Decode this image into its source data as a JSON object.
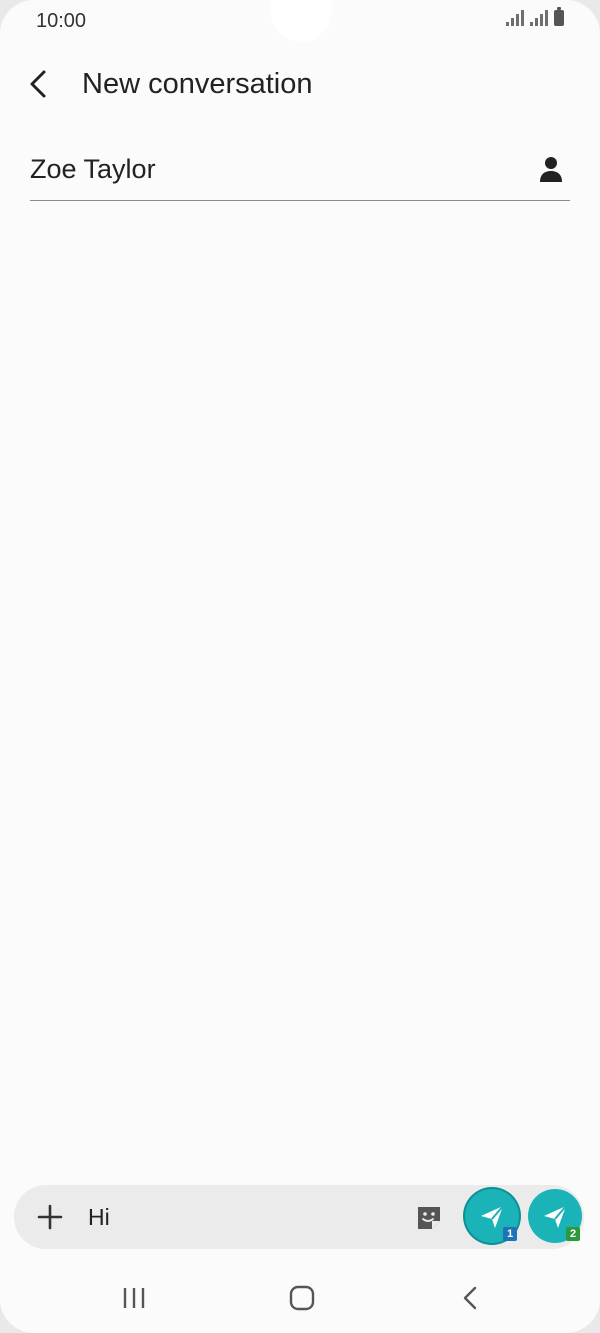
{
  "status_bar": {
    "time": "10:00"
  },
  "header": {
    "title": "New conversation",
    "back_icon": "chevron-left-icon"
  },
  "recipient": {
    "value": "Zoe Taylor",
    "contact_icon": "person-icon"
  },
  "composer": {
    "message_value": "Hi",
    "add_icon": "plus-icon",
    "sticker_icon": "sticker-icon",
    "send_buttons": [
      {
        "sim_label": "1",
        "icon": "send-icon"
      },
      {
        "sim_label": "2",
        "icon": "send-icon"
      }
    ]
  },
  "nav_bar": {
    "recent_icon": "recent-apps-icon",
    "home_icon": "home-icon",
    "back_icon": "nav-back-icon"
  },
  "colors": {
    "send_button": "#1ab3b8",
    "sim1_badge": "#1e72b8",
    "sim2_badge": "#2c9a3c",
    "background": "#fbfbfb"
  }
}
